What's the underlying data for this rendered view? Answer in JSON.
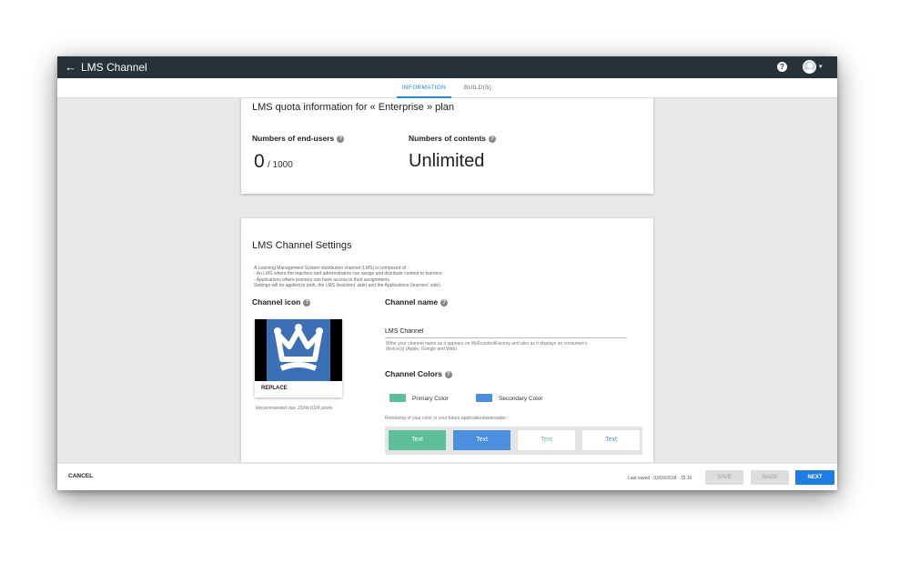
{
  "header": {
    "back_icon": "arrow-left-icon",
    "title": "LMS Channel",
    "help_icon": "question-circle-icon",
    "avatar_icon": "user-avatar-icon",
    "caret": "▾"
  },
  "tabs": [
    {
      "label": "INFORMATION",
      "active": true
    },
    {
      "label": "BUILD(S)",
      "active": false
    }
  ],
  "quota": {
    "title": "LMS quota information for « Enterprise » plan",
    "end_users_label": "Numbers of end-users",
    "end_users_value": "0",
    "end_users_max": "/ 1000",
    "contents_label": "Numbers of contents",
    "contents_value": "Unlimited"
  },
  "settings": {
    "title": "LMS Channel Settings",
    "description": [
      "A Learning Management System distribution channel (LMS) is composed of :",
      " - An LMS where the teachers and administrators can assign and distribute content to learners",
      " - Applications where learners can have access to their assignments",
      "Settings will be applied to both, the LMS (teachers' side) and the Applications (learners' side)."
    ],
    "channel_icon_label": "Channel icon",
    "replace_label": "REPLACE",
    "recommended": "Recommanded size 1024x1024 pixels",
    "channel_name_label": "Channel name",
    "channel_name_value": "LMS Channel",
    "channel_name_help": [
      "Write your channel name as it appears on MyEcontentFactory and also as it displays on consumer's",
      "device(s) (Apple, Google and Web)."
    ],
    "channel_colors_label": "Channel Colors",
    "primary_color_label": "Primary Color",
    "secondary_color_label": "Secondary Color",
    "primary_color": "#5dbf9a",
    "secondary_color": "#4a8fe0",
    "rendering_label": "Rendering of your color in your future application/webreader:",
    "preview_text": "Text"
  },
  "footer": {
    "cancel_label": "CANCEL",
    "last_saved": "Last saved : 02/09/2018 - 15:16",
    "save_label": "SAVE",
    "back_label": "BACK",
    "next_label": "NEXT"
  }
}
